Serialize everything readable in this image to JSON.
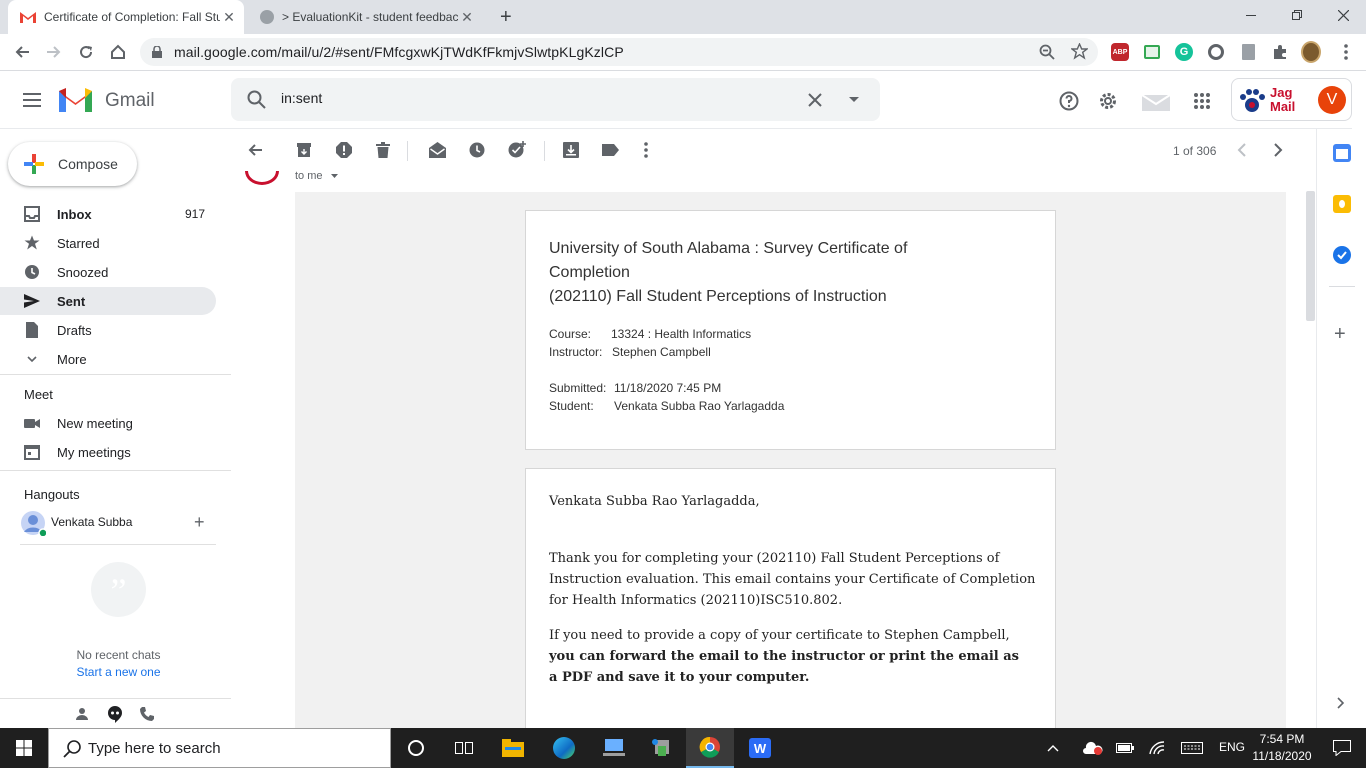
{
  "browser": {
    "tabs": [
      {
        "title": "Certificate of Completion: Fall Stu",
        "active": true
      },
      {
        "title": "> EvaluationKit - student feedbac",
        "active": false
      }
    ],
    "url": "mail.google.com/mail/u/2/#sent/FMfcgxwKjTWdKfFkmjvSlwtpKLgKzlCP"
  },
  "gmail": {
    "product_name": "Gmail",
    "search_value": "in:sent",
    "compose_label": "Compose",
    "account_initial": "V",
    "jagmail_text_1": "Jag",
    "jagmail_text_2": "Mail",
    "pagination": "1 of 306",
    "nav": [
      {
        "label": "Inbox",
        "count": "917",
        "icon": "inbox-icon"
      },
      {
        "label": "Starred",
        "count": "",
        "icon": "star-icon"
      },
      {
        "label": "Snoozed",
        "count": "",
        "icon": "clock-icon"
      },
      {
        "label": "Sent",
        "count": "",
        "icon": "send-icon",
        "selected": true
      },
      {
        "label": "Drafts",
        "count": "",
        "icon": "draft-icon"
      },
      {
        "label": "More",
        "count": "",
        "icon": "chevron-down-icon"
      }
    ],
    "meet": {
      "heading": "Meet",
      "items": [
        {
          "label": "New meeting"
        },
        {
          "label": "My meetings"
        }
      ]
    },
    "hangouts": {
      "heading": "Hangouts",
      "user": "Venkata Subba",
      "empty_text": "No recent chats",
      "start_link": "Start a new one"
    },
    "to_me": "to me"
  },
  "email": {
    "card_title_line1": "University of South Alabama : Survey Certificate of",
    "card_title_line2": "Completion",
    "card_title_line3": "(202110) Fall Student Perceptions of Instruction",
    "course_label": "Course:",
    "course_value": "13324 : Health Informatics",
    "instructor_label": "Instructor:",
    "instructor_value": "Stephen Campbell",
    "submitted_label": "Submitted:",
    "submitted_value": "11/18/2020 7:45 PM",
    "student_label": "Student:",
    "student_value": "Venkata Subba Rao Yarlagadda",
    "greeting": "Venkata Subba Rao Yarlagadda,",
    "para1_line1": "Thank you for completing your (202110) Fall Student Perceptions of",
    "para1_line2": "Instruction evaluation. This email contains your Certificate of Completion",
    "para1_line3": "for Health Informatics (202110)ISC510.802.",
    "para2_line1": "If you need to provide a copy of your certificate to Stephen Campbell,",
    "para2_line2": "you can forward the email to the instructor or print the email as",
    "para2_line3": "a PDF and save it to your computer."
  },
  "taskbar": {
    "search_placeholder": "Type here to search",
    "language": "ENG",
    "time": "7:54 PM",
    "date": "11/18/2020"
  }
}
